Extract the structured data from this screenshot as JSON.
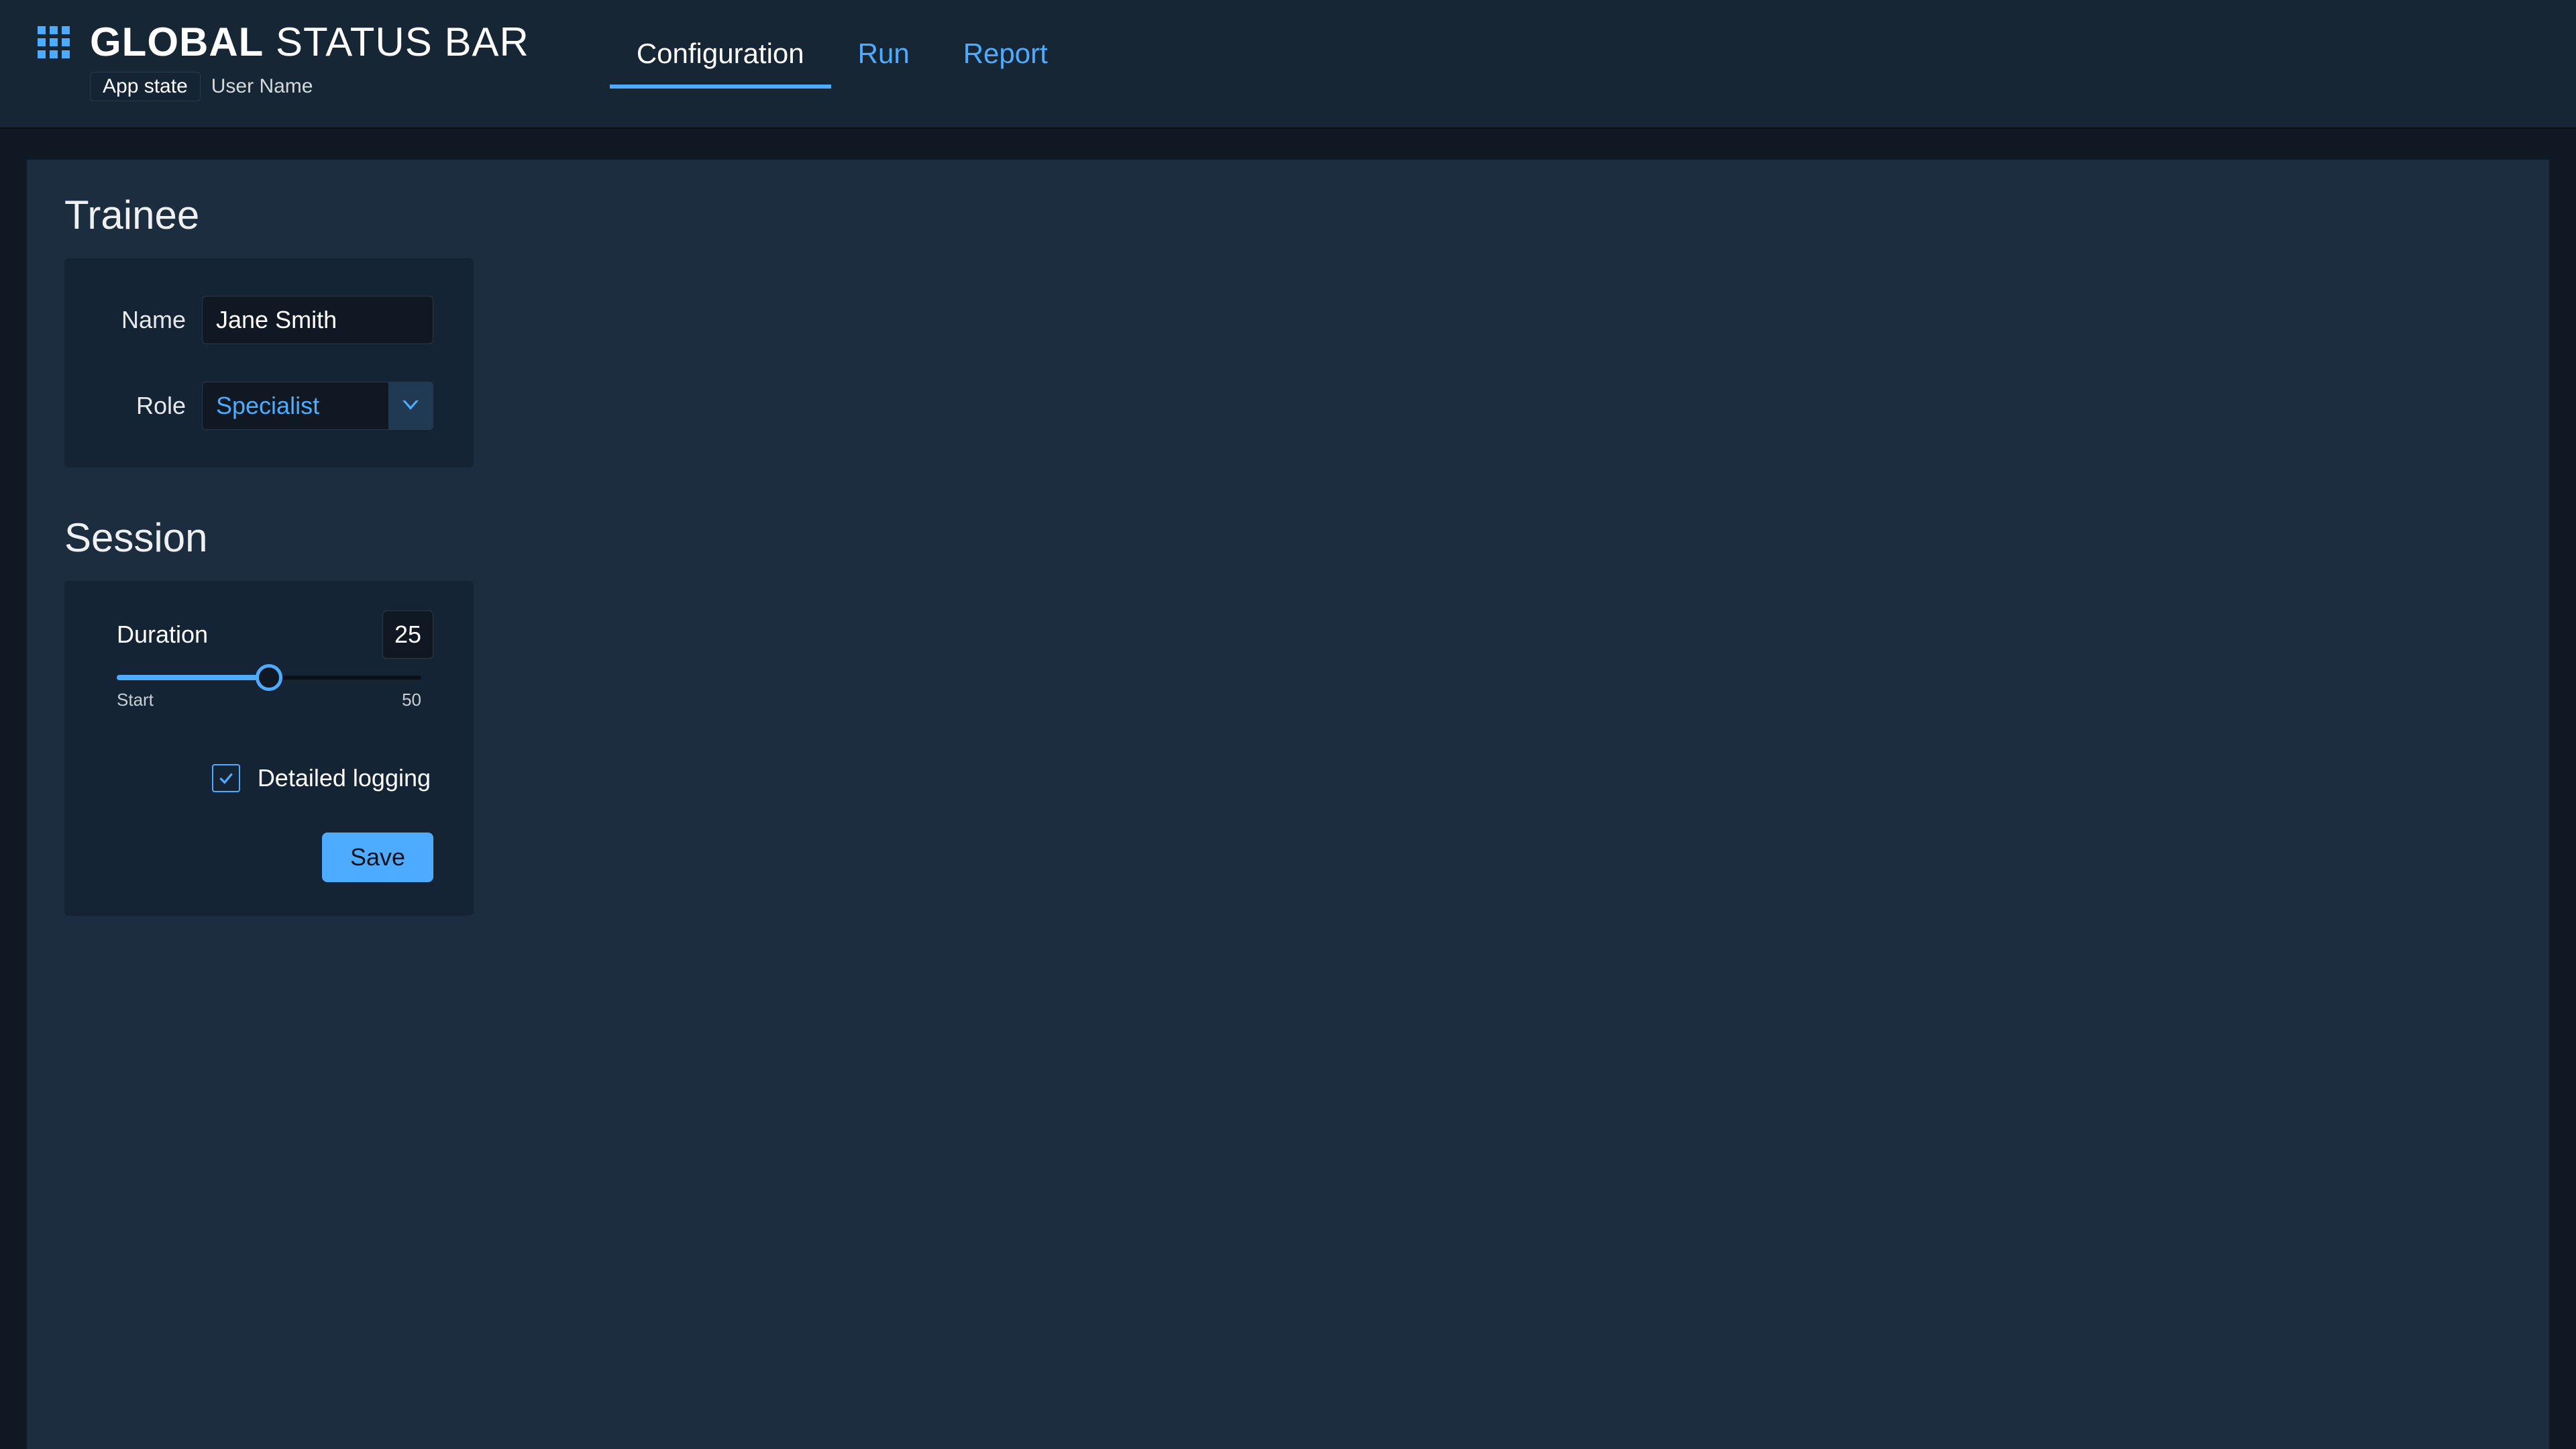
{
  "header": {
    "title_bold": "GLOBAL",
    "title_light": "STATUS BAR",
    "state_badge": "App state",
    "user_name": "User Name"
  },
  "tabs": {
    "configuration": "Configuration",
    "run": "Run",
    "report": "Report",
    "active": "configuration"
  },
  "trainee": {
    "heading": "Trainee",
    "name_label": "Name",
    "name_value": "Jane Smith",
    "role_label": "Role",
    "role_value": "Specialist"
  },
  "session": {
    "heading": "Session",
    "duration_label": "Duration",
    "duration_value": "25",
    "slider_min_label": "Start",
    "slider_max_label": "50",
    "slider_min": 0,
    "slider_max": 50,
    "logging_label": "Detailed logging",
    "logging_checked": true,
    "save_label": "Save"
  }
}
